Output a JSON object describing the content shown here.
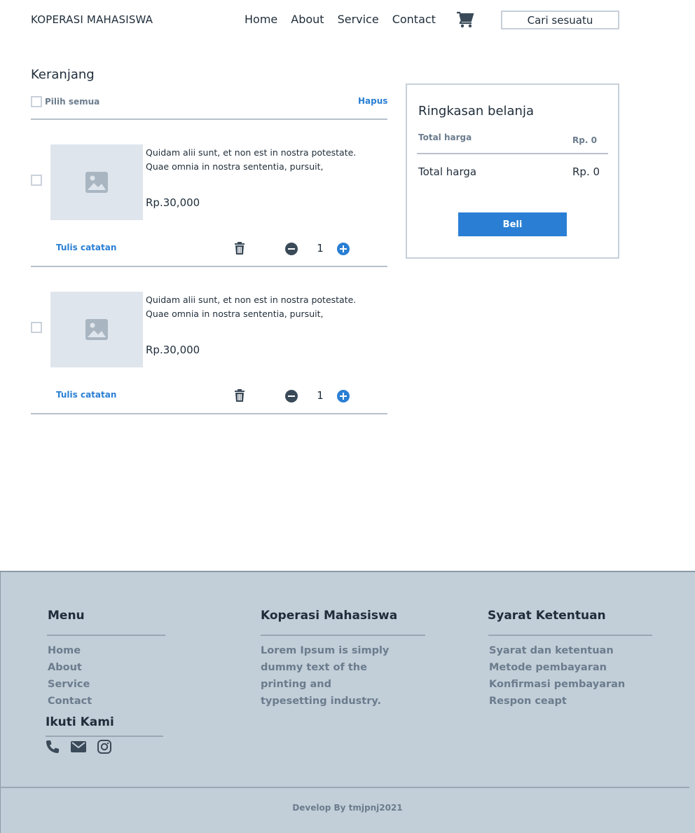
{
  "header": {
    "brand": "KOPERASI MAHASISWA",
    "nav": [
      "Home",
      "About",
      "Service",
      "Contact"
    ],
    "cart_icon": "shopping-cart-icon",
    "search_placeholder": "Cari sesuatu"
  },
  "cart": {
    "title": "Keranjang",
    "select_all_label": "Pilih semua",
    "delete_label": "Hapus",
    "items": [
      {
        "description": "Quidam alii sunt, et non est in nostra potestate. Quae omnia in nostra sententia, pursuit,",
        "price": "Rp.30,000",
        "note_label": "Tulis catatan",
        "quantity": "1",
        "image_icon": "image-placeholder-icon"
      },
      {
        "description": "Quidam alii sunt, et non est in nostra potestate. Quae omnia in nostra sententia, pursuit,",
        "price": "Rp.30,000",
        "note_label": "Tulis catatan",
        "quantity": "1",
        "image_icon": "image-placeholder-icon"
      }
    ]
  },
  "summary": {
    "title": "Ringkasan belanja",
    "subtotal_label": "Total harga",
    "subtotal_value": "Rp. 0",
    "total_label": "Total harga",
    "total_value": "Rp. 0",
    "buy_label": "Beli"
  },
  "footer": {
    "menu_title": "Menu",
    "menu_links": [
      "Home",
      "About",
      "Service",
      "Contact"
    ],
    "follow_title": "Ikuti Kami",
    "social_icons": [
      "phone-icon",
      "mail-icon",
      "instagram-icon"
    ],
    "about_title": "Koperasi Mahasiswa",
    "about_text": " Lorem Ipsum is simply dummy text of  the printing and typesetting industry.",
    "terms_title": "Syarat Ketentuan",
    "terms_links": [
      "Syarat dan ketentuan",
      "Metode pembayaran",
      "Konfirmasi pembayaran",
      "Respon ceapt"
    ],
    "credit": "Develop By tmjpnj2021"
  },
  "colors": {
    "accent": "#2a7fd4",
    "footer_bg": "#c2ced8",
    "text": "#1f2d3a",
    "muted": "#6b7c8d"
  }
}
